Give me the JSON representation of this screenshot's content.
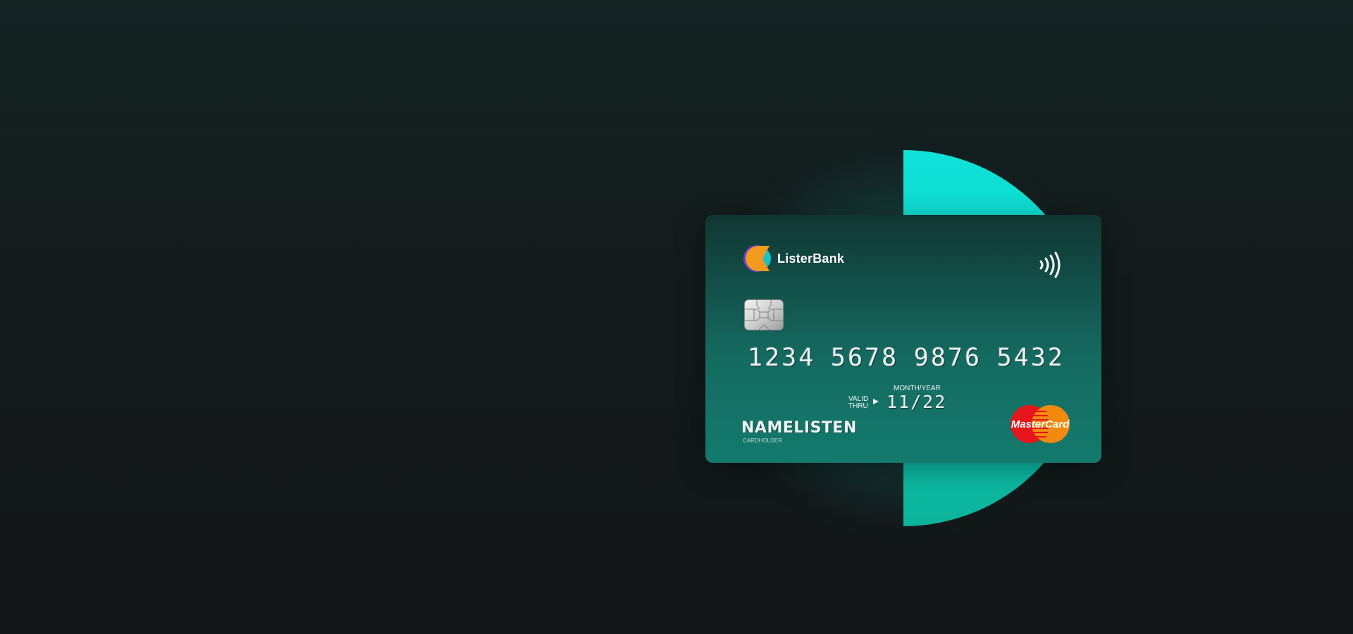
{
  "card": {
    "bank_name": "ListerBank",
    "number_groups": [
      "1234",
      "5678",
      "9876",
      "5432"
    ],
    "expiry_label_top": "MONTH/YEAR",
    "valid_label_1": "VALID",
    "valid_label_2": "THRU",
    "expiry": "11/22",
    "holder_name": "NAMELISTEN",
    "holder_label": "CARDHOLDER",
    "network": "MasterCard"
  },
  "icons": {
    "logo": "listerbank-logo-icon",
    "contactless": "contactless-icon",
    "chip": "chip-icon",
    "network": "mastercard-logo-icon"
  },
  "colors": {
    "background": "#141a1b",
    "accent": "#0fe3da",
    "card_top": "#133b37",
    "card_bottom": "#137a6d"
  }
}
